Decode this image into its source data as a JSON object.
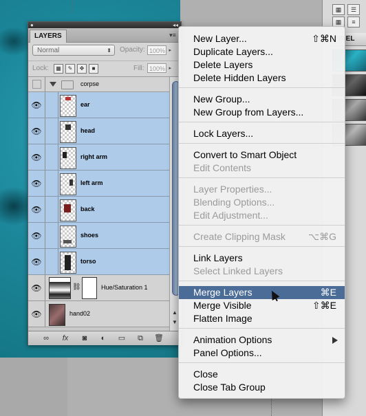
{
  "panel": {
    "tab_label": "LAYERS",
    "blend_mode": "Normal",
    "opacity_label": "Opacity:",
    "opacity_value": "100%",
    "lock_label": "Lock:",
    "fill_label": "Fill:",
    "fill_value": "100%",
    "group_name": "corpse",
    "layers": [
      {
        "name": "ear",
        "selected": true
      },
      {
        "name": "head",
        "selected": true
      },
      {
        "name": "right arm",
        "selected": true
      },
      {
        "name": "left arm",
        "selected": true
      },
      {
        "name": "back",
        "selected": true
      },
      {
        "name": "shoes",
        "selected": true
      },
      {
        "name": "torso",
        "selected": true
      }
    ],
    "adjustment_layer": "Hue/Saturation 1",
    "bottom_layer": "hand02"
  },
  "right_panel": {
    "header": "ANNEL"
  },
  "menu": {
    "items": [
      {
        "label": "New Layer...",
        "shortcut": "⇧⌘N",
        "disabled": false
      },
      {
        "label": "Duplicate Layers...",
        "shortcut": "",
        "disabled": false
      },
      {
        "label": "Delete Layers",
        "shortcut": "",
        "disabled": false
      },
      {
        "label": "Delete Hidden Layers",
        "shortcut": "",
        "disabled": false
      },
      {
        "label": "New Group...",
        "shortcut": "",
        "disabled": false
      },
      {
        "label": "New Group from Layers...",
        "shortcut": "",
        "disabled": false
      },
      {
        "label": "Lock Layers...",
        "shortcut": "",
        "disabled": false
      },
      {
        "label": "Convert to Smart Object",
        "shortcut": "",
        "disabled": false
      },
      {
        "label": "Edit Contents",
        "shortcut": "",
        "disabled": true
      },
      {
        "label": "Layer Properties...",
        "shortcut": "",
        "disabled": true
      },
      {
        "label": "Blending Options...",
        "shortcut": "",
        "disabled": true
      },
      {
        "label": "Edit Adjustment...",
        "shortcut": "",
        "disabled": true
      },
      {
        "label": "Create Clipping Mask",
        "shortcut": "⌥⌘G",
        "disabled": true
      },
      {
        "label": "Link Layers",
        "shortcut": "",
        "disabled": false
      },
      {
        "label": "Select Linked Layers",
        "shortcut": "",
        "disabled": true
      },
      {
        "label": "Merge Layers",
        "shortcut": "⌘E",
        "disabled": false,
        "highlighted": true
      },
      {
        "label": "Merge Visible",
        "shortcut": "⇧⌘E",
        "disabled": false
      },
      {
        "label": "Flatten Image",
        "shortcut": "",
        "disabled": false
      },
      {
        "label": "Animation Options",
        "shortcut": "",
        "disabled": false,
        "submenu": true
      },
      {
        "label": "Panel Options...",
        "shortcut": "",
        "disabled": false
      },
      {
        "label": "Close",
        "shortcut": "",
        "disabled": false
      },
      {
        "label": "Close Tab Group",
        "shortcut": "",
        "disabled": false
      }
    ]
  },
  "colors": {
    "selection": "#aecbea",
    "menu_highlight": "#4a6c97",
    "canvas": "#1b8598"
  }
}
